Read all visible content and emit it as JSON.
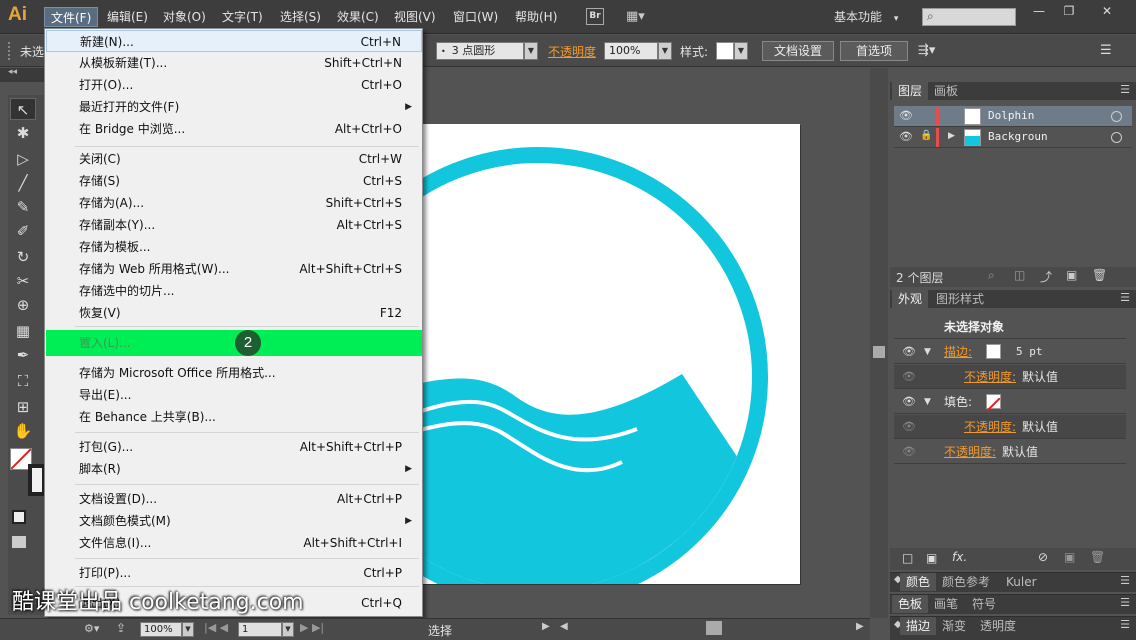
{
  "app": {
    "logo": "Ai"
  },
  "menubar": {
    "items": [
      "文件(F)",
      "编辑(E)",
      "对象(O)",
      "文字(T)",
      "选择(S)",
      "效果(C)",
      "视图(V)",
      "窗口(W)",
      "帮助(H)"
    ],
    "active": "文件(F)",
    "bridge_label": "Br",
    "workspace": "基本功能",
    "workspace_arrow": "▾",
    "window_controls": [
      "—",
      "❐",
      "✕"
    ]
  },
  "control_bar": {
    "selection_label": "未选",
    "brush_points": "3 点圆形",
    "opacity_label": "不透明度",
    "opacity_value": "100%",
    "style_label": "样式",
    "doc_setup_button": "文档设置",
    "prefs_button": "首选项"
  },
  "file_menu": {
    "items": [
      {
        "label": "新建(N)...",
        "shortcut": "Ctrl+N"
      },
      {
        "label": "从模板新建(T)...",
        "shortcut": "Shift+Ctrl+N"
      },
      {
        "label": "打开(O)...",
        "shortcut": "Ctrl+O"
      },
      {
        "label": "最近打开的文件(F)",
        "shortcut": "",
        "submenu": true
      },
      {
        "label": "在 Bridge 中浏览...",
        "shortcut": "Alt+Ctrl+O"
      },
      {
        "label": "关闭(C)",
        "shortcut": "Ctrl+W"
      },
      {
        "label": "存储(S)",
        "shortcut": "Ctrl+S"
      },
      {
        "label": "存储为(A)...",
        "shortcut": "Shift+Ctrl+S"
      },
      {
        "label": "存储副本(Y)...",
        "shortcut": "Alt+Ctrl+S"
      },
      {
        "label": "存储为模板...",
        "shortcut": ""
      },
      {
        "label": "存储为 Web 所用格式(W)...",
        "shortcut": "Alt+Shift+Ctrl+S"
      },
      {
        "label": "存储选中的切片...",
        "shortcut": ""
      },
      {
        "label": "恢复(V)",
        "shortcut": "F12"
      },
      {
        "label": "置入(L)...",
        "shortcut": ""
      },
      {
        "label": "存储为 Microsoft Office 所用格式...",
        "shortcut": ""
      },
      {
        "label": "导出(E)...",
        "shortcut": ""
      },
      {
        "label": "在 Behance 上共享(B)...",
        "shortcut": ""
      },
      {
        "label": "打包(G)...",
        "shortcut": "Alt+Shift+Ctrl+P"
      },
      {
        "label": "脚本(R)",
        "shortcut": "",
        "submenu": true
      },
      {
        "label": "文档设置(D)...",
        "shortcut": "Alt+Ctrl+P"
      },
      {
        "label": "文档颜色模式(M)",
        "shortcut": "",
        "submenu": true
      },
      {
        "label": "文件信息(I)...",
        "shortcut": "Alt+Shift+Ctrl+I"
      },
      {
        "label": "打印(P)...",
        "shortcut": "Ctrl+P"
      },
      {
        "label": "退出(X)",
        "shortcut": "Ctrl+Q"
      }
    ],
    "step_badge": "2"
  },
  "layers_panel": {
    "tabs": [
      "图层",
      "画板"
    ],
    "layers": [
      {
        "name": "Dolphin",
        "selected": true
      },
      {
        "name": "Backgroun",
        "selected": false
      }
    ],
    "footer_count": "2 个图层"
  },
  "appearance_panel": {
    "tabs": [
      "外观",
      "图形样式"
    ],
    "title": "未选择对象",
    "stroke_label": "描边:",
    "stroke_value": "5 pt",
    "opacity_label": "不透明度:",
    "opacity_value": "默认值",
    "fill_label": "填色:",
    "fill_opacity_label": "不透明度:",
    "fill_opacity_value": "默认值",
    "obj_opacity_label": "不透明度:",
    "obj_opacity_value": "默认值",
    "footer_fx": "fx."
  },
  "mini_panels": [
    {
      "tabs": [
        "颜色",
        "颜色参考",
        "Kuler"
      ]
    },
    {
      "tabs": [
        "色板",
        "画笔",
        "符号"
      ]
    },
    {
      "tabs": [
        "描边",
        "渐变",
        "透明度"
      ]
    }
  ],
  "status_bar": {
    "zoom": "100%",
    "artboard_num": "1",
    "tool_label": "选择"
  },
  "watermark": "酷课堂出品 coolketang.com",
  "colors": {
    "accent_cyan": "#12c6de",
    "highlight_green": "#00ee55",
    "badge_green": "#1c5f30",
    "layer_red": "#e84c4c"
  }
}
